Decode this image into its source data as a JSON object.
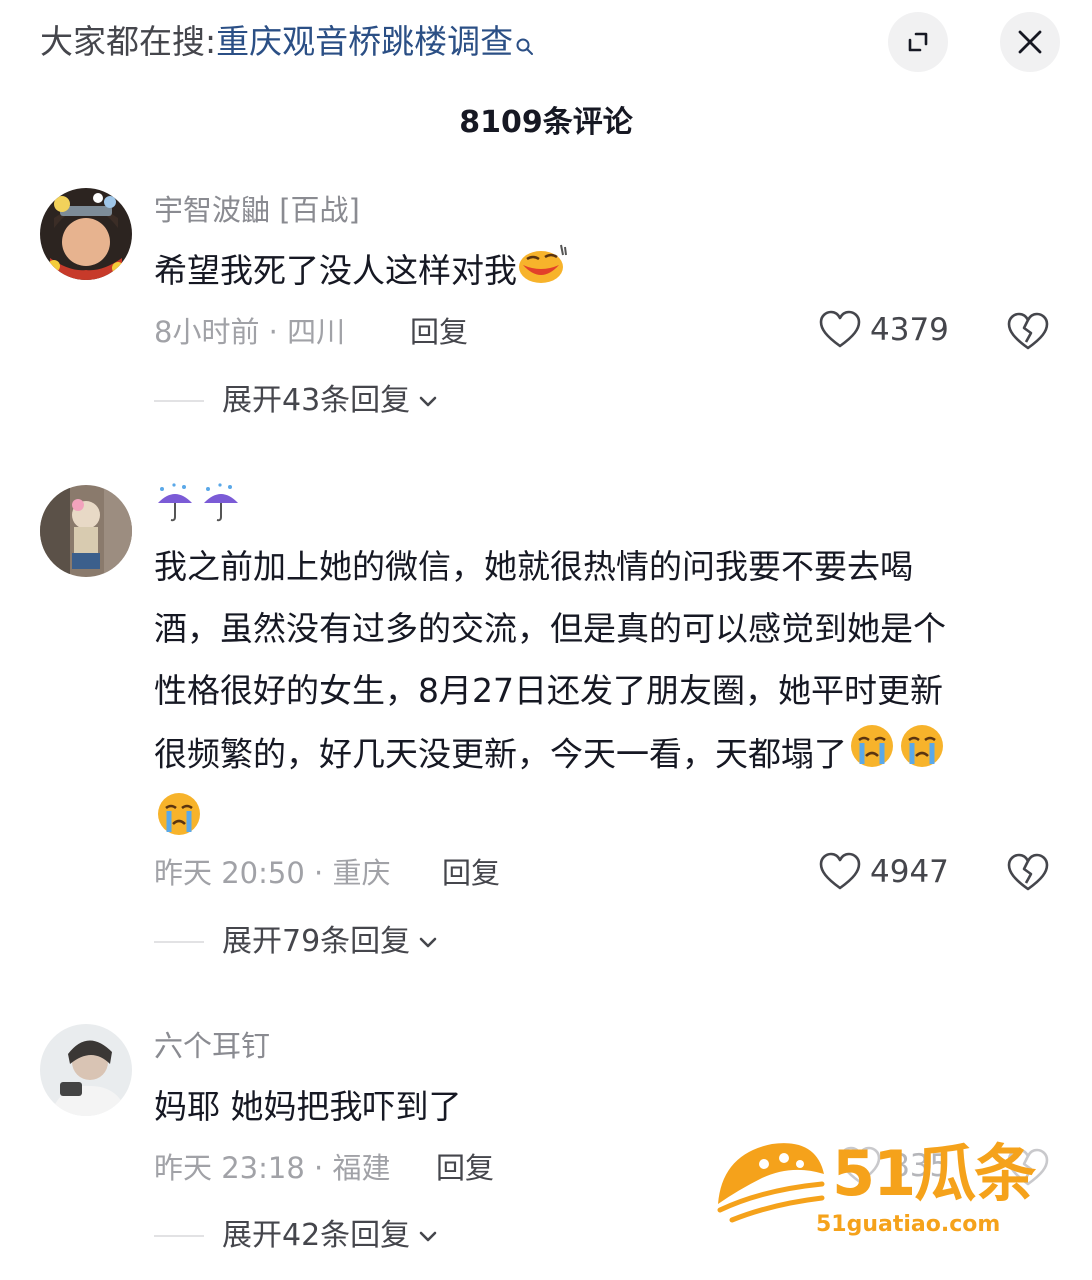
{
  "header": {
    "search_prefix": "大家都在搜:",
    "search_term": "重庆观音桥跳楼调查",
    "comment_count": "8109条评论"
  },
  "comments": [
    {
      "username": "宇智波鼬 [百战]",
      "text": "希望我死了没人这样对我",
      "time_location": "8小时前 · 四川",
      "reply_label": "回复",
      "likes": "4379",
      "expand_label": "展开43条回复"
    },
    {
      "username": "☔☔",
      "text_lines": [
        "我之前加上她的微信，她就很热情的问我要不要去喝",
        "酒，虽然没有过多的交流，但是真的可以感觉到她是个",
        "性格很好的女生，8月27日还发了朋友圈，她平时更新",
        "很频繁的，好几天没更新，今天一看，天都塌了"
      ],
      "time_location": "昨天 20:50 · 重庆",
      "reply_label": "回复",
      "likes": "4947",
      "expand_label": "展开79条回复"
    },
    {
      "username": "六个耳钉",
      "text": "妈耶 她妈把我吓到了",
      "time_location": "昨天 23:18 · 福建",
      "reply_label": "回复",
      "likes": "835",
      "expand_label": "展开42条回复"
    }
  ],
  "watermark": {
    "brand": "51瓜条",
    "url": "51guatiao.com"
  }
}
